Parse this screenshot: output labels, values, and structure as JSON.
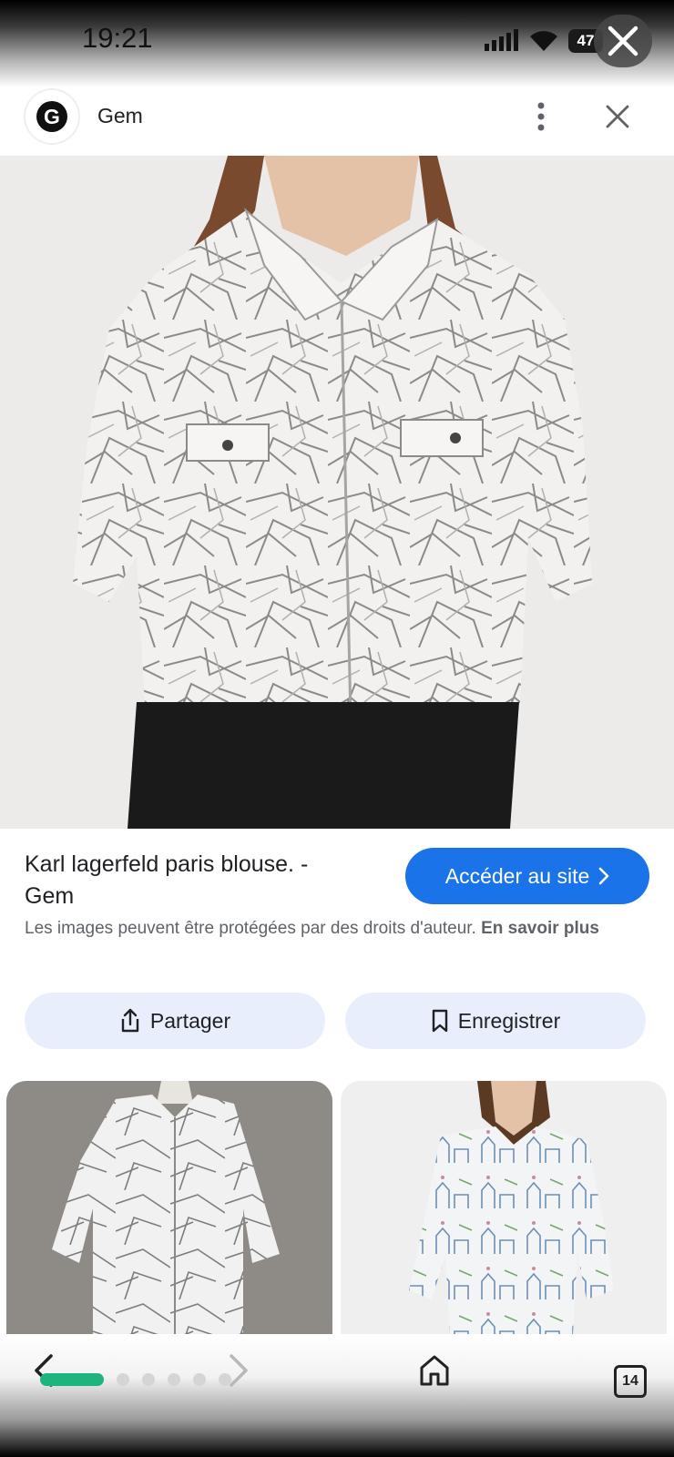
{
  "status_bar": {
    "time": "19:21",
    "battery": "47"
  },
  "header": {
    "site_name": "Gem",
    "logo_letter": "G"
  },
  "result": {
    "title": "Karl lagerfeld paris blouse. - Gem",
    "visit_label": "Accéder au site",
    "copyright_text": "Les images peuvent être protégées par des droits d'auteur.",
    "learn_more": "En savoir plus"
  },
  "actions": {
    "share_label": "Partager",
    "save_label": "Enregistrer"
  },
  "bottom_nav": {
    "tabs_count": "14"
  },
  "colors": {
    "accent": "#1a73e8",
    "chip_bg": "#e8eefb",
    "progress": "#1fb47e"
  }
}
